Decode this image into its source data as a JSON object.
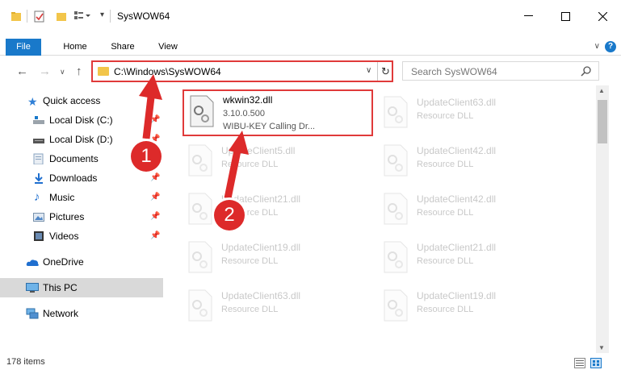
{
  "window": {
    "title": "SysWOW64"
  },
  "ribbon": {
    "tabs": [
      "File",
      "Home",
      "Share",
      "View"
    ]
  },
  "address": {
    "path": "C:\\Windows\\SysWOW64",
    "search_placeholder": "Search SysWOW64"
  },
  "sidebar": {
    "items": [
      {
        "label": "Quick access",
        "icon": "star-icon",
        "pinned": false
      },
      {
        "label": "Local Disk (C:)",
        "icon": "drive-icon",
        "pinned": true
      },
      {
        "label": "Local Disk (D:)",
        "icon": "drive-icon",
        "pinned": true
      },
      {
        "label": "Documents",
        "icon": "documents-icon",
        "pinned": true
      },
      {
        "label": "Downloads",
        "icon": "download-icon",
        "pinned": true
      },
      {
        "label": "Music",
        "icon": "music-icon",
        "pinned": true
      },
      {
        "label": "Pictures",
        "icon": "pictures-icon",
        "pinned": true
      },
      {
        "label": "Videos",
        "icon": "videos-icon",
        "pinned": true
      },
      {
        "label": "OneDrive",
        "icon": "cloud-icon",
        "pinned": false
      },
      {
        "label": "This PC",
        "icon": "computer-icon",
        "pinned": false,
        "selected": true
      },
      {
        "label": "Network",
        "icon": "network-icon",
        "pinned": false
      }
    ]
  },
  "files": {
    "selected": {
      "name": "wkwin32.dll",
      "version": "3.10.0.500",
      "description": "WIBU-KEY Calling Dr..."
    },
    "faded": [
      {
        "name": "UpdateClient63.dll",
        "type": "Resource DLL"
      },
      {
        "name": "UpdateClient5.dll",
        "type": "Resource DLL"
      },
      {
        "name": "UpdateClient42.dll",
        "type": "Resource DLL"
      },
      {
        "name": "UpdateClient21.dll",
        "type": "Resource DLL"
      },
      {
        "name": "UpdateClient42.dll",
        "type": "Resource DLL"
      },
      {
        "name": "UpdateClient19.dll",
        "type": "Resource DLL"
      },
      {
        "name": "UpdateClient21.dll",
        "type": "Resource DLL"
      },
      {
        "name": "UpdateClient63.dll",
        "type": "Resource DLL"
      },
      {
        "name": "UpdateClient19.dll",
        "type": "Resource DLL"
      }
    ]
  },
  "status": {
    "item_count": "178 items"
  },
  "annotations": {
    "step1": "1",
    "step2": "2",
    "color": "#dd2a2a"
  }
}
